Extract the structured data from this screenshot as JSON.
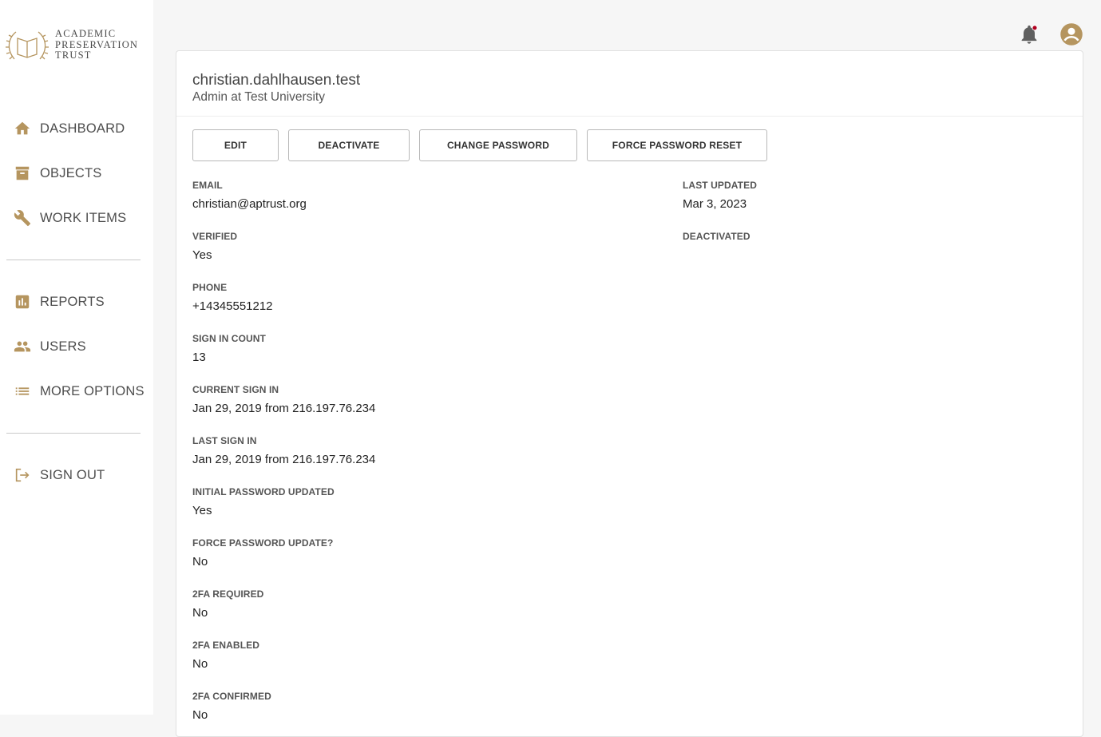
{
  "logo": {
    "line1": "ACADEMIC",
    "line2": "PRESERVATION",
    "line3": "TRUST",
    "color": "#b5955f"
  },
  "sidebar": {
    "items": [
      {
        "label": "DASHBOARD",
        "icon": "home-icon"
      },
      {
        "label": "OBJECTS",
        "icon": "archive-icon"
      },
      {
        "label": "WORK ITEMS",
        "icon": "wrench-icon"
      },
      {
        "label": "REPORTS",
        "icon": "bar-chart-icon"
      },
      {
        "label": "USERS",
        "icon": "people-icon"
      },
      {
        "label": "MORE OPTIONS",
        "icon": "list-icon"
      },
      {
        "label": "SIGN OUT",
        "icon": "logout-icon"
      }
    ]
  },
  "accent_color": "#b5955f",
  "notification_dot_color": "#b00020",
  "user": {
    "username": "christian.dahlhausen.test",
    "role": "Admin at Test University"
  },
  "buttons": {
    "edit": "EDIT",
    "deactivate": "DEACTIVATE",
    "change_password": "CHANGE PASSWORD",
    "force_password_reset": "FORCE PASSWORD RESET"
  },
  "fields": {
    "email": {
      "label": "EMAIL",
      "value": "christian@aptrust.org"
    },
    "last_updated": {
      "label": "LAST UPDATED",
      "value": "Mar 3, 2023"
    },
    "verified": {
      "label": "VERIFIED",
      "value": "Yes"
    },
    "deactivated": {
      "label": "DEACTIVATED",
      "value": ""
    },
    "phone": {
      "label": "PHONE",
      "value": "+14345551212"
    },
    "sign_in_count": {
      "label": "SIGN IN COUNT",
      "value": "13"
    },
    "current_sign_in": {
      "label": "CURRENT SIGN IN",
      "value": "Jan 29, 2019 from 216.197.76.234"
    },
    "last_sign_in": {
      "label": "LAST SIGN IN",
      "value": "Jan 29, 2019 from 216.197.76.234"
    },
    "initial_password_updated": {
      "label": "INITIAL PASSWORD UPDATED",
      "value": "Yes"
    },
    "force_password_update": {
      "label": "FORCE PASSWORD UPDATE?",
      "value": "No"
    },
    "twofa_required": {
      "label": "2FA REQUIRED",
      "value": "No"
    },
    "twofa_enabled": {
      "label": "2FA ENABLED",
      "value": "No"
    },
    "twofa_confirmed": {
      "label": "2FA CONFIRMED",
      "value": "No"
    }
  }
}
